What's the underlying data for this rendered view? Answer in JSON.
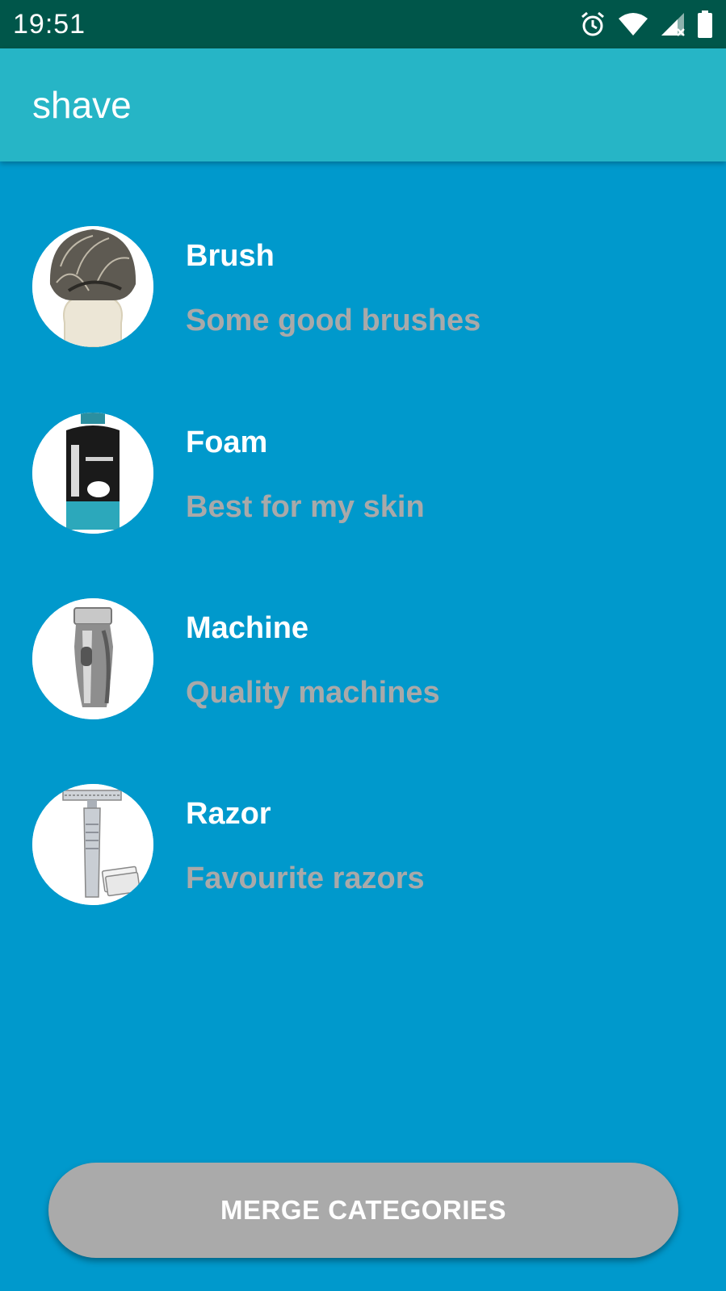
{
  "status_bar": {
    "time": "19:51",
    "icons": [
      "alarm-icon",
      "wifi-icon",
      "signal-icon",
      "battery-icon"
    ]
  },
  "app_bar": {
    "title": "shave"
  },
  "categories": [
    {
      "title": "Brush",
      "subtitle": "Some good brushes",
      "image": "shaving-brush"
    },
    {
      "title": "Foam",
      "subtitle": "Best for my skin",
      "image": "shaving-foam-can"
    },
    {
      "title": "Machine",
      "subtitle": "Quality machines",
      "image": "electric-shaver"
    },
    {
      "title": "Razor",
      "subtitle": "Favourite razors",
      "image": "safety-razor"
    }
  ],
  "merge_button": {
    "label": "MERGE CATEGORIES"
  },
  "colors": {
    "status_bar": "#00564a",
    "app_bar": "#26b5c6",
    "background": "#0099cc",
    "subtitle": "#a9a9a9",
    "button": "#aaaaaa"
  }
}
